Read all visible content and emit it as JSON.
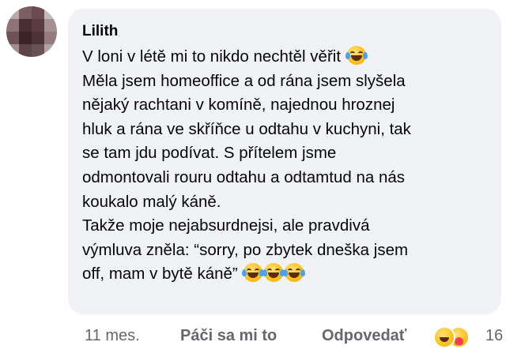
{
  "comment": {
    "author": "Lilith",
    "lines": [
      "V loni v létě mi to nikdo nechtěl věřit",
      "Měla jsem homeoffice a od rána jsem slyšela",
      "nějaký rachtani v komíně, najednou hroznej",
      "hluk a rána ve skříňce u odtahu v kuchyni, tak",
      "se tam jdu podívat. S přítelem jsme",
      "odmontovali rouru odtahu a odtamtud na nás",
      "koukalo malý káně.",
      "Takže moje nejabsurdnejsi, ale pravdivá",
      "výmluva zněla: “sorry, po zbytek dneška jsem",
      "off, mam v bytě káně”"
    ],
    "emoji_icons": [
      "face-with-tears-of-joy-icon"
    ]
  },
  "actions": {
    "time": "11 mes.",
    "like_label": "Páči sa mi to",
    "reply_label": "Odpovedať",
    "reaction_count": "16",
    "reaction_icons": [
      "haha-reaction-icon",
      "care-reaction-icon"
    ]
  },
  "colors": {
    "bubble": "#f0f2f5",
    "secondary_text": "#65676b",
    "primary_text": "#050505"
  }
}
